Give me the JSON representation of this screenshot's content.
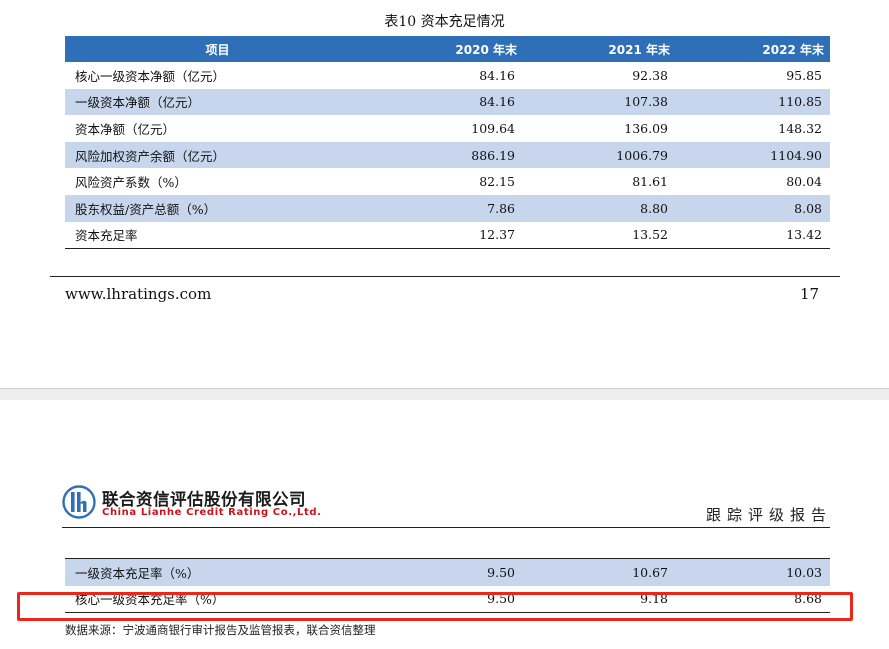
{
  "table10": {
    "title": "表10   资本充足情况",
    "headers": [
      "项目",
      "2020 年末",
      "2021 年末",
      "2022 年末"
    ],
    "rows": [
      [
        "核心一级资本净额（亿元）",
        "84.16",
        "92.38",
        "95.85"
      ],
      [
        "一级资本净额（亿元）",
        "84.16",
        "107.38",
        "110.85"
      ],
      [
        "资本净额（亿元）",
        "109.64",
        "136.09",
        "148.32"
      ],
      [
        "风险加权资产余额（亿元）",
        "886.19",
        "1006.79",
        "1104.90"
      ],
      [
        "风险资产系数（%）",
        "82.15",
        "81.61",
        "80.04"
      ],
      [
        "股东权益/资产总额（%）",
        "7.86",
        "8.80",
        "8.08"
      ],
      [
        "资本充足率",
        "12.37",
        "13.52",
        "13.42"
      ]
    ]
  },
  "footer": {
    "url": "www.lhratings.com",
    "page_number": "17"
  },
  "header": {
    "company_cn": "联合资信评估股份有限公司",
    "company_en": "China Lianhe Credit Rating Co.,Ltd.",
    "report_type": "跟踪评级报告"
  },
  "table_continued": {
    "rows": [
      [
        "一级资本充足率（%）",
        "9.50",
        "10.67",
        "10.03"
      ],
      [
        "核心一级资本充足率（%）",
        "9.50",
        "9.18",
        "8.68"
      ]
    ]
  },
  "source_note": "数据来源：宁波通商银行审计报告及监管报表，联合资信整理",
  "colors": {
    "header_blue": "#2e6fb8",
    "row_alt": "#c7d6ec",
    "highlight_red": "#e8281d",
    "logo_red": "#c8141c"
  }
}
